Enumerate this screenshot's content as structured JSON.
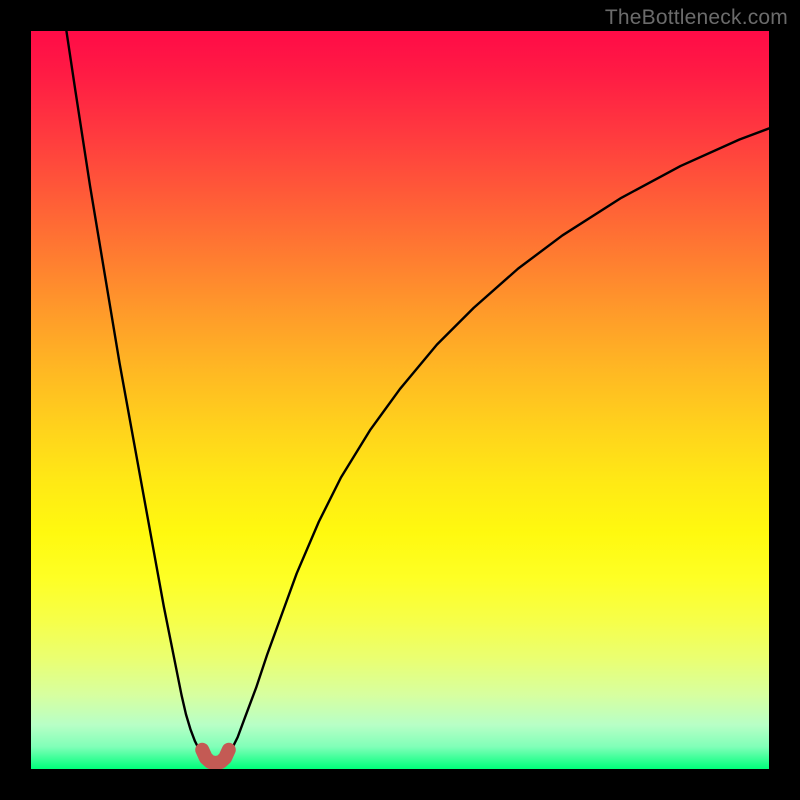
{
  "watermark": "TheBottleneck.com",
  "chart_data": {
    "type": "line",
    "title": "",
    "xlabel": "",
    "ylabel": "",
    "xlim": [
      0,
      100
    ],
    "ylim": [
      0,
      100
    ],
    "grid": false,
    "legend": false,
    "series": [
      {
        "name": "left-branch",
        "x": [
          4.8,
          6,
          8,
          10,
          12,
          14,
          16,
          17,
          18,
          19,
          19.8,
          20.4,
          21,
          21.6,
          22.2,
          23,
          23.7
        ],
        "y": [
          100,
          92,
          79,
          67,
          55,
          44,
          33,
          27.5,
          22,
          17,
          13,
          10,
          7.4,
          5.4,
          3.8,
          2.2,
          1.5
        ]
      },
      {
        "name": "right-branch",
        "x": [
          26.3,
          27,
          28,
          29,
          30.5,
          32,
          34,
          36,
          39,
          42,
          46,
          50,
          55,
          60,
          66,
          72,
          80,
          88,
          96,
          100
        ],
        "y": [
          1.5,
          2.3,
          4.3,
          7,
          11,
          15.5,
          21,
          26.5,
          33.5,
          39.5,
          46,
          51.5,
          57.5,
          62.5,
          67.8,
          72.3,
          77.4,
          81.7,
          85.3,
          86.8
        ]
      },
      {
        "name": "min-marker",
        "x": [
          23.2,
          23.7,
          24.3,
          25,
          25.7,
          26.3,
          26.8
        ],
        "y": [
          2.6,
          1.5,
          0.95,
          0.8,
          0.95,
          1.5,
          2.6
        ]
      }
    ],
    "background_gradient": {
      "direction": "top-to-bottom",
      "stops": [
        {
          "pos": 0.0,
          "color": "#ff0b47"
        },
        {
          "pos": 0.5,
          "color": "#ffcc1f"
        },
        {
          "pos": 0.8,
          "color": "#f3ff55"
        },
        {
          "pos": 1.0,
          "color": "#00ff7a"
        }
      ]
    }
  }
}
